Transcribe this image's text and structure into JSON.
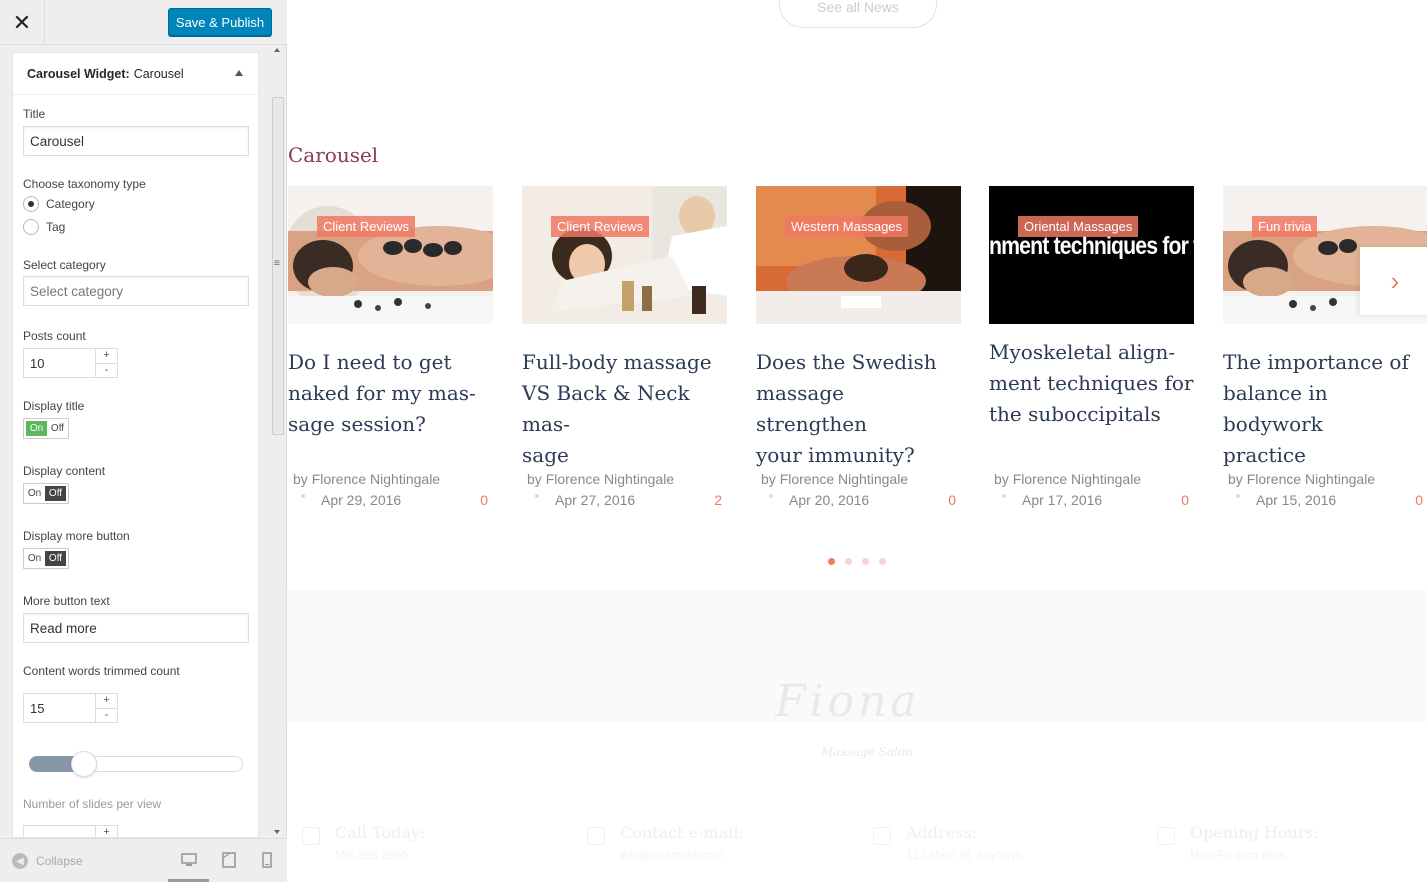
{
  "customizer": {
    "close_icon": "close-icon",
    "save_label": "Save & Publish",
    "panel": {
      "widget_name": "Carousel Widget:",
      "widget_title": "Carousel"
    },
    "fields": {
      "title_label": "Title",
      "title_value": "Carousel",
      "taxonomy_label": "Choose taxonomy type",
      "taxonomy_options": [
        "Category",
        "Tag"
      ],
      "taxonomy_selected": "Category",
      "category_label": "Select category",
      "category_placeholder": "Select category",
      "posts_count_label": "Posts count",
      "posts_count_value": "10",
      "display_title_label": "Display title",
      "display_content_label": "Display content",
      "display_more_label": "Display more button",
      "toggle_on": "On",
      "toggle_off": "Off",
      "display_title_state": "On",
      "display_content_state": "Off",
      "display_more_state": "Off",
      "more_text_label": "More button text",
      "more_text_value": "Read more",
      "trim_label": "Content words trimmed count",
      "trim_value": "15",
      "slides_label": "Number of slides per view"
    },
    "footer": {
      "collapse_label": "Collapse",
      "devices": [
        "desktop-icon",
        "tablet-icon",
        "mobile-icon"
      ]
    }
  },
  "preview": {
    "see_all_label": "See all News",
    "carousel_heading": "Carousel",
    "cards": [
      {
        "category": "Client Reviews",
        "title_lines": [
          "Do I need to get",
          "naked for my mas-",
          "sage session?"
        ],
        "author_prefix": "by",
        "author": "Florence Nightingale",
        "date": "Apr 29, 2016",
        "comments": "0"
      },
      {
        "category": "Client Reviews",
        "title_lines": [
          "Full-body massage",
          "VS Back & Neck mas-",
          "sage"
        ],
        "author_prefix": "by",
        "author": "Florence Nightingale",
        "date": "Apr 27, 2016",
        "comments": "2"
      },
      {
        "category": "Western Massages",
        "title_lines": [
          "Does the Swedish",
          "massage strengthen",
          "your immunity?"
        ],
        "author_prefix": "by",
        "author": "Florence Nightingale",
        "date": "Apr 20, 2016",
        "comments": "0"
      },
      {
        "category": "Oriental Massages",
        "image_text": "nment techniques for t",
        "title_lines": [
          "Myoskeletal align-",
          "ment techniques for",
          "the suboccipitals"
        ],
        "author_prefix": "by",
        "author": "Florence Nightingale",
        "date": "Apr 17, 2016",
        "comments": "0"
      },
      {
        "category": "Fun trivia",
        "title_lines": [
          "The importance of",
          "balance in bodywork",
          "practice"
        ],
        "author_prefix": "by",
        "author": "Florence Nightingale",
        "date": "Apr 15, 2016",
        "comments": "0"
      }
    ],
    "pager_count": 4,
    "pager_active": 1,
    "logo": "Fiona",
    "logo_sub": "Massage Salon",
    "contacts": [
      {
        "title": "Call Today:",
        "value": "555 555 5555"
      },
      {
        "title": "Contact e-mail:",
        "value": "info@example.com"
      },
      {
        "title": "Address:",
        "value": "123 Main St, Anytown"
      },
      {
        "title": "Opening Hours:",
        "value": "Mon-Fri 9am-8pm"
      }
    ],
    "accent_color": "#f07a64",
    "heading_color": "#8b3a52"
  }
}
